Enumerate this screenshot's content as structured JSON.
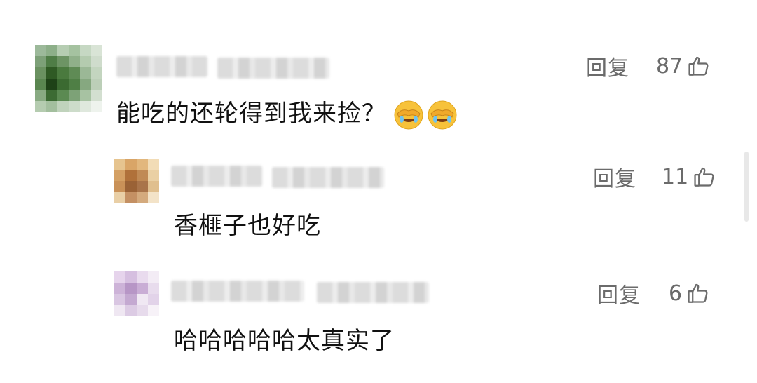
{
  "comments": [
    {
      "text": "能吃的还轮得到我来捡？",
      "reply_label": "回复",
      "likes": "87",
      "emojis": [
        "facepalm-laugh-emoji",
        "facepalm-laugh-emoji"
      ]
    },
    {
      "text": "香榧子也好吃",
      "reply_label": "回复",
      "likes": "11"
    },
    {
      "text": "哈哈哈哈哈太真实了",
      "reply_label": "回复",
      "likes": "6"
    }
  ],
  "icons": {
    "like": "thumbs-up-icon",
    "emoji": "facepalm-laugh-emoji"
  },
  "colors": {
    "text": "#111111",
    "secondary": "#6b6b6b",
    "background": "#ffffff"
  }
}
